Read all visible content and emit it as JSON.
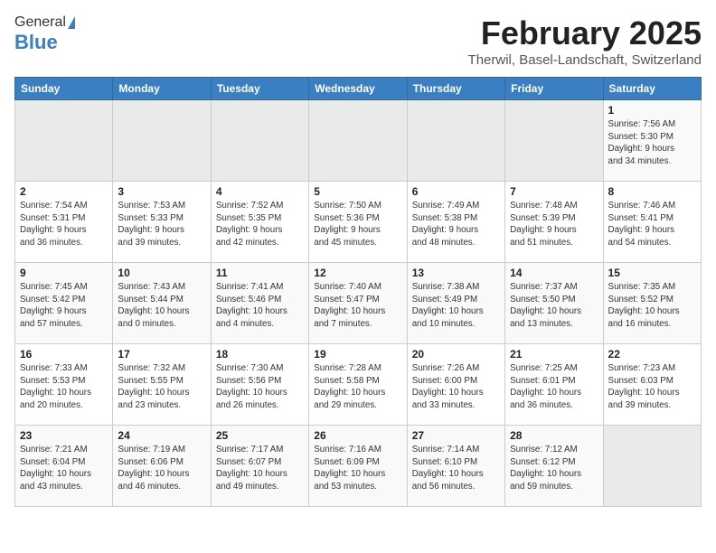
{
  "logo": {
    "general": "General",
    "blue": "Blue"
  },
  "header": {
    "month": "February 2025",
    "location": "Therwil, Basel-Landschaft, Switzerland"
  },
  "weekdays": [
    "Sunday",
    "Monday",
    "Tuesday",
    "Wednesday",
    "Thursday",
    "Friday",
    "Saturday"
  ],
  "weeks": [
    [
      {
        "day": "",
        "info": ""
      },
      {
        "day": "",
        "info": ""
      },
      {
        "day": "",
        "info": ""
      },
      {
        "day": "",
        "info": ""
      },
      {
        "day": "",
        "info": ""
      },
      {
        "day": "",
        "info": ""
      },
      {
        "day": "1",
        "info": "Sunrise: 7:56 AM\nSunset: 5:30 PM\nDaylight: 9 hours\nand 34 minutes."
      }
    ],
    [
      {
        "day": "2",
        "info": "Sunrise: 7:54 AM\nSunset: 5:31 PM\nDaylight: 9 hours\nand 36 minutes."
      },
      {
        "day": "3",
        "info": "Sunrise: 7:53 AM\nSunset: 5:33 PM\nDaylight: 9 hours\nand 39 minutes."
      },
      {
        "day": "4",
        "info": "Sunrise: 7:52 AM\nSunset: 5:35 PM\nDaylight: 9 hours\nand 42 minutes."
      },
      {
        "day": "5",
        "info": "Sunrise: 7:50 AM\nSunset: 5:36 PM\nDaylight: 9 hours\nand 45 minutes."
      },
      {
        "day": "6",
        "info": "Sunrise: 7:49 AM\nSunset: 5:38 PM\nDaylight: 9 hours\nand 48 minutes."
      },
      {
        "day": "7",
        "info": "Sunrise: 7:48 AM\nSunset: 5:39 PM\nDaylight: 9 hours\nand 51 minutes."
      },
      {
        "day": "8",
        "info": "Sunrise: 7:46 AM\nSunset: 5:41 PM\nDaylight: 9 hours\nand 54 minutes."
      }
    ],
    [
      {
        "day": "9",
        "info": "Sunrise: 7:45 AM\nSunset: 5:42 PM\nDaylight: 9 hours\nand 57 minutes."
      },
      {
        "day": "10",
        "info": "Sunrise: 7:43 AM\nSunset: 5:44 PM\nDaylight: 10 hours\nand 0 minutes."
      },
      {
        "day": "11",
        "info": "Sunrise: 7:41 AM\nSunset: 5:46 PM\nDaylight: 10 hours\nand 4 minutes."
      },
      {
        "day": "12",
        "info": "Sunrise: 7:40 AM\nSunset: 5:47 PM\nDaylight: 10 hours\nand 7 minutes."
      },
      {
        "day": "13",
        "info": "Sunrise: 7:38 AM\nSunset: 5:49 PM\nDaylight: 10 hours\nand 10 minutes."
      },
      {
        "day": "14",
        "info": "Sunrise: 7:37 AM\nSunset: 5:50 PM\nDaylight: 10 hours\nand 13 minutes."
      },
      {
        "day": "15",
        "info": "Sunrise: 7:35 AM\nSunset: 5:52 PM\nDaylight: 10 hours\nand 16 minutes."
      }
    ],
    [
      {
        "day": "16",
        "info": "Sunrise: 7:33 AM\nSunset: 5:53 PM\nDaylight: 10 hours\nand 20 minutes."
      },
      {
        "day": "17",
        "info": "Sunrise: 7:32 AM\nSunset: 5:55 PM\nDaylight: 10 hours\nand 23 minutes."
      },
      {
        "day": "18",
        "info": "Sunrise: 7:30 AM\nSunset: 5:56 PM\nDaylight: 10 hours\nand 26 minutes."
      },
      {
        "day": "19",
        "info": "Sunrise: 7:28 AM\nSunset: 5:58 PM\nDaylight: 10 hours\nand 29 minutes."
      },
      {
        "day": "20",
        "info": "Sunrise: 7:26 AM\nSunset: 6:00 PM\nDaylight: 10 hours\nand 33 minutes."
      },
      {
        "day": "21",
        "info": "Sunrise: 7:25 AM\nSunset: 6:01 PM\nDaylight: 10 hours\nand 36 minutes."
      },
      {
        "day": "22",
        "info": "Sunrise: 7:23 AM\nSunset: 6:03 PM\nDaylight: 10 hours\nand 39 minutes."
      }
    ],
    [
      {
        "day": "23",
        "info": "Sunrise: 7:21 AM\nSunset: 6:04 PM\nDaylight: 10 hours\nand 43 minutes."
      },
      {
        "day": "24",
        "info": "Sunrise: 7:19 AM\nSunset: 6:06 PM\nDaylight: 10 hours\nand 46 minutes."
      },
      {
        "day": "25",
        "info": "Sunrise: 7:17 AM\nSunset: 6:07 PM\nDaylight: 10 hours\nand 49 minutes."
      },
      {
        "day": "26",
        "info": "Sunrise: 7:16 AM\nSunset: 6:09 PM\nDaylight: 10 hours\nand 53 minutes."
      },
      {
        "day": "27",
        "info": "Sunrise: 7:14 AM\nSunset: 6:10 PM\nDaylight: 10 hours\nand 56 minutes."
      },
      {
        "day": "28",
        "info": "Sunrise: 7:12 AM\nSunset: 6:12 PM\nDaylight: 10 hours\nand 59 minutes."
      },
      {
        "day": "",
        "info": ""
      }
    ]
  ]
}
